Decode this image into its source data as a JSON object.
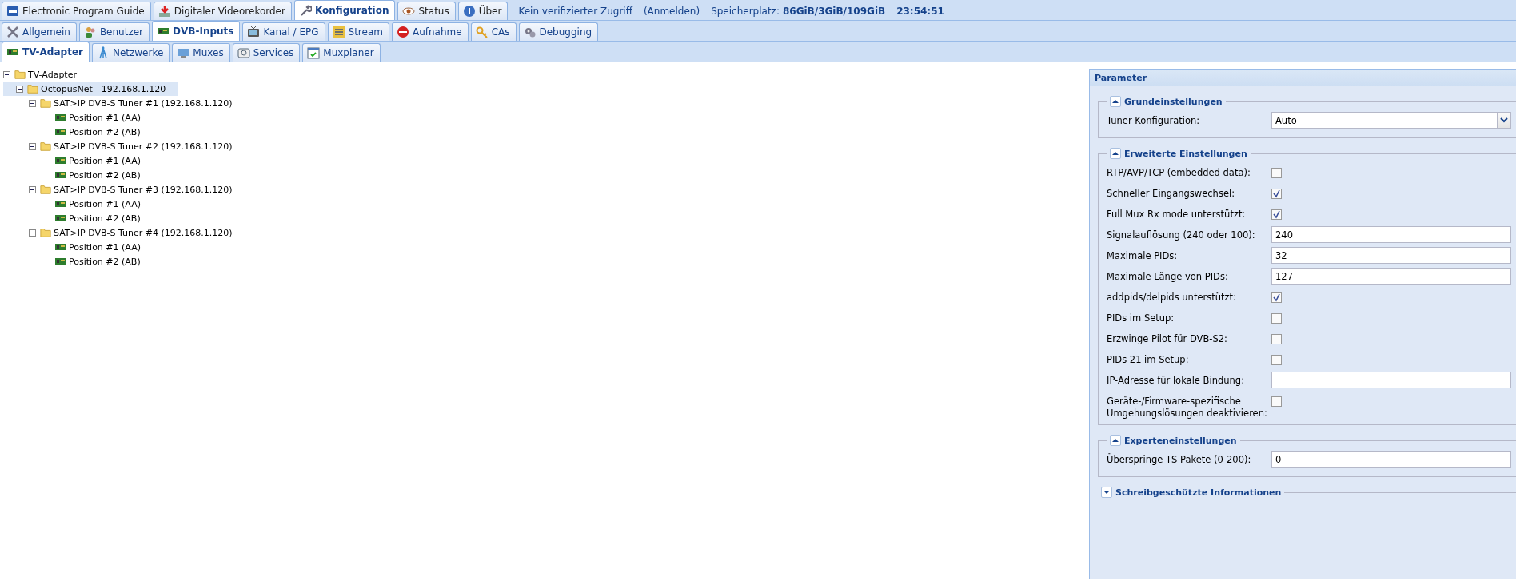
{
  "main_tabs": [
    {
      "label": "Electronic Program Guide",
      "selected": false
    },
    {
      "label": "Digitaler Videorekorder",
      "selected": false
    },
    {
      "label": "Konfiguration",
      "selected": true
    },
    {
      "label": "Status",
      "selected": false
    },
    {
      "label": "Über",
      "selected": false
    }
  ],
  "status": {
    "access": "Kein verifizierter Zugriff",
    "login": "(Anmelden)",
    "storage_label": "Speicherplatz:",
    "storage": "86GiB/3GiB/109GiB",
    "time": "23:54:51"
  },
  "config_tabs": [
    {
      "label": "Allgemein",
      "selected": false
    },
    {
      "label": "Benutzer",
      "selected": false
    },
    {
      "label": "DVB-Inputs",
      "selected": true
    },
    {
      "label": "Kanal / EPG",
      "selected": false
    },
    {
      "label": "Stream",
      "selected": false
    },
    {
      "label": "Aufnahme",
      "selected": false
    },
    {
      "label": "CAs",
      "selected": false
    },
    {
      "label": "Debugging",
      "selected": false
    }
  ],
  "dvb_tabs": [
    {
      "label": "TV-Adapter",
      "selected": true
    },
    {
      "label": "Netzwerke",
      "selected": false
    },
    {
      "label": "Muxes",
      "selected": false
    },
    {
      "label": "Services",
      "selected": false
    },
    {
      "label": "Muxplaner",
      "selected": false
    }
  ],
  "tree": [
    {
      "label": "TV-Adapter",
      "kind": "folder",
      "expanded": true,
      "selected": false,
      "children": [
        {
          "label": "OctopusNet - 192.168.1.120",
          "kind": "folder",
          "expanded": true,
          "selected": true,
          "children": [
            {
              "label": "SAT>IP DVB-S Tuner #1 (192.168.1.120)",
              "kind": "folder",
              "expanded": true,
              "selected": false,
              "children": [
                {
                  "label": "Position #1 (AA)",
                  "kind": "adapter",
                  "selected": false
                },
                {
                  "label": "Position #2 (AB)",
                  "kind": "adapter",
                  "selected": false
                }
              ]
            },
            {
              "label": "SAT>IP DVB-S Tuner #2 (192.168.1.120)",
              "kind": "folder",
              "expanded": true,
              "selected": false,
              "children": [
                {
                  "label": "Position #1 (AA)",
                  "kind": "adapter",
                  "selected": false
                },
                {
                  "label": "Position #2 (AB)",
                  "kind": "adapter",
                  "selected": false
                }
              ]
            },
            {
              "label": "SAT>IP DVB-S Tuner #3 (192.168.1.120)",
              "kind": "folder",
              "expanded": true,
              "selected": false,
              "children": [
                {
                  "label": "Position #1 (AA)",
                  "kind": "adapter",
                  "selected": false
                },
                {
                  "label": "Position #2 (AB)",
                  "kind": "adapter",
                  "selected": false
                }
              ]
            },
            {
              "label": "SAT>IP DVB-S Tuner #4 (192.168.1.120)",
              "kind": "folder",
              "expanded": true,
              "selected": false,
              "children": [
                {
                  "label": "Position #1 (AA)",
                  "kind": "adapter",
                  "selected": false
                },
                {
                  "label": "Position #2 (AB)",
                  "kind": "adapter",
                  "selected": false
                }
              ]
            }
          ]
        }
      ]
    }
  ],
  "parameter": {
    "title": "Parameter",
    "sections": [
      {
        "title": "Grundeinstellungen",
        "expanded": true,
        "fields": [
          {
            "kind": "select",
            "label": "Tuner Konfiguration:",
            "value": "Auto"
          }
        ]
      },
      {
        "title": "Erweiterte Einstellungen",
        "expanded": true,
        "fields": [
          {
            "kind": "checkbox",
            "label": "RTP/AVP/TCP (embedded data):",
            "checked": false
          },
          {
            "kind": "checkbox",
            "label": "Schneller Eingangswechsel:",
            "checked": true
          },
          {
            "kind": "checkbox",
            "label": "Full Mux Rx mode unterstützt:",
            "checked": true
          },
          {
            "kind": "text",
            "label": "Signalauflösung (240 oder 100):",
            "value": "240"
          },
          {
            "kind": "text",
            "label": "Maximale PIDs:",
            "value": "32"
          },
          {
            "kind": "text",
            "label": "Maximale Länge von PIDs:",
            "value": "127"
          },
          {
            "kind": "checkbox",
            "label": "addpids/delpids unterstützt:",
            "checked": true
          },
          {
            "kind": "checkbox",
            "label": "PIDs im Setup:",
            "checked": false
          },
          {
            "kind": "checkbox",
            "label": "Erzwinge Pilot für DVB-S2:",
            "checked": false
          },
          {
            "kind": "checkbox",
            "label": "PIDs 21 im Setup:",
            "checked": false
          },
          {
            "kind": "text",
            "label": "IP-Adresse für lokale Bindung:"
          },
          {
            "kind": "checkbox",
            "label": "Geräte-/Firmware-spezifische Umgehungslösungen deaktivieren:",
            "checked": false
          }
        ]
      },
      {
        "title": "Experteneinstellungen",
        "expanded": true,
        "fields": [
          {
            "kind": "text",
            "label": "Überspringe TS Pakete (0-200):",
            "value": "0"
          }
        ]
      },
      {
        "title": "Schreibgeschützte Informationen",
        "expanded": false
      }
    ]
  }
}
